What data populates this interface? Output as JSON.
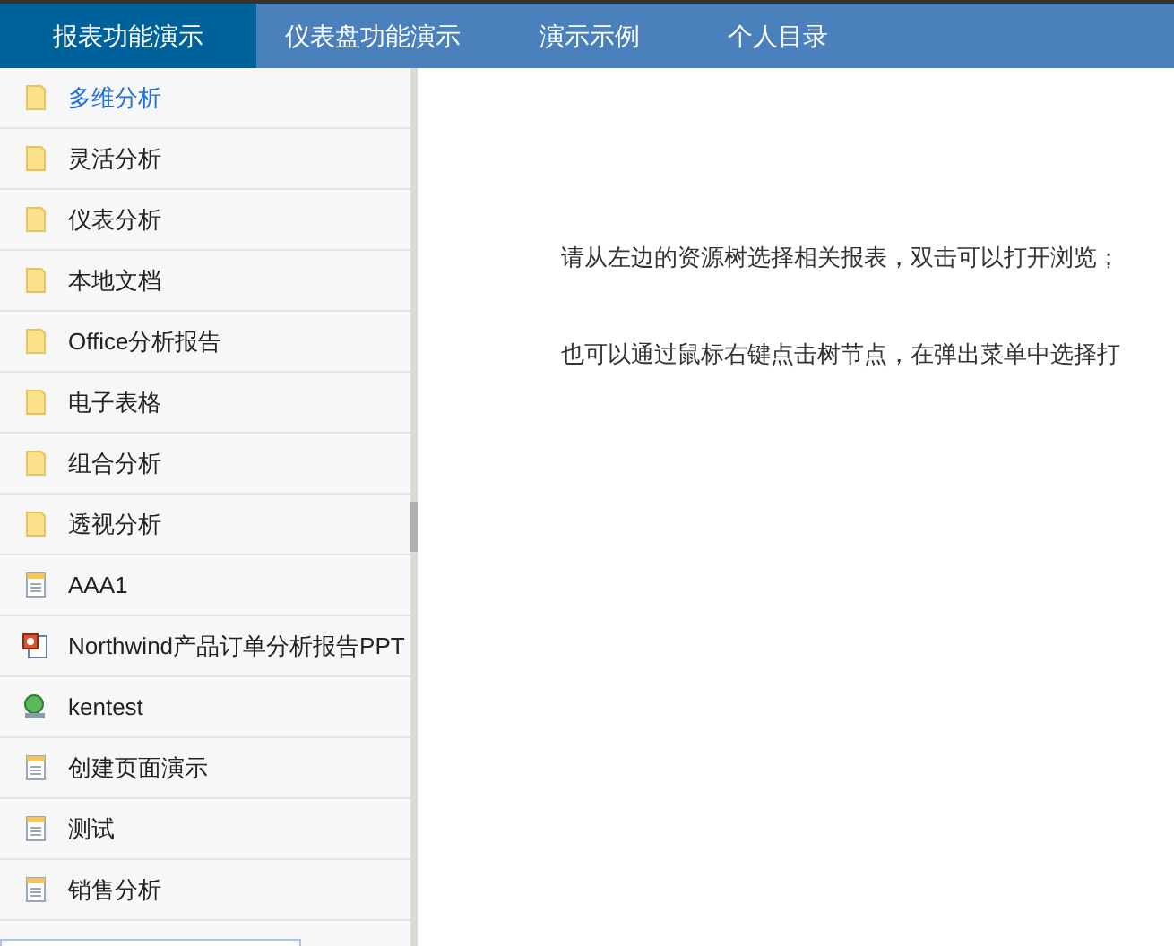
{
  "tabs": [
    {
      "label": "报表功能演示",
      "selected": true
    },
    {
      "label": "仪表盘功能演示",
      "selected": false
    },
    {
      "label": "演示示例",
      "selected": false
    },
    {
      "label": "个人目录",
      "selected": false
    }
  ],
  "sidebar": {
    "items": [
      {
        "label": "多维分析",
        "kind": "folder",
        "selected": true
      },
      {
        "label": "灵活分析",
        "kind": "folder",
        "selected": false
      },
      {
        "label": "仪表分析",
        "kind": "folder",
        "selected": false
      },
      {
        "label": "本地文档",
        "kind": "folder",
        "selected": false
      },
      {
        "label": "Office分析报告",
        "kind": "folder",
        "selected": false
      },
      {
        "label": "电子表格",
        "kind": "folder",
        "selected": false
      },
      {
        "label": "组合分析",
        "kind": "folder",
        "selected": false
      },
      {
        "label": "透视分析",
        "kind": "folder",
        "selected": false
      },
      {
        "label": "AAA1",
        "kind": "report",
        "selected": false
      },
      {
        "label": "Northwind产品订单分析报告PPT",
        "kind": "slides",
        "selected": false
      },
      {
        "label": "kentest",
        "kind": "connection",
        "selected": false
      },
      {
        "label": "创建页面演示",
        "kind": "report",
        "selected": false
      },
      {
        "label": "测试",
        "kind": "report",
        "selected": false
      },
      {
        "label": "销售分析",
        "kind": "report",
        "selected": false
      }
    ]
  },
  "content": {
    "paragraphs": [
      "请从左边的资源树选择相关报表，双击可以打开浏览；",
      "也可以通过鼠标右键点击树节点，在弹出菜单中选择打"
    ]
  }
}
